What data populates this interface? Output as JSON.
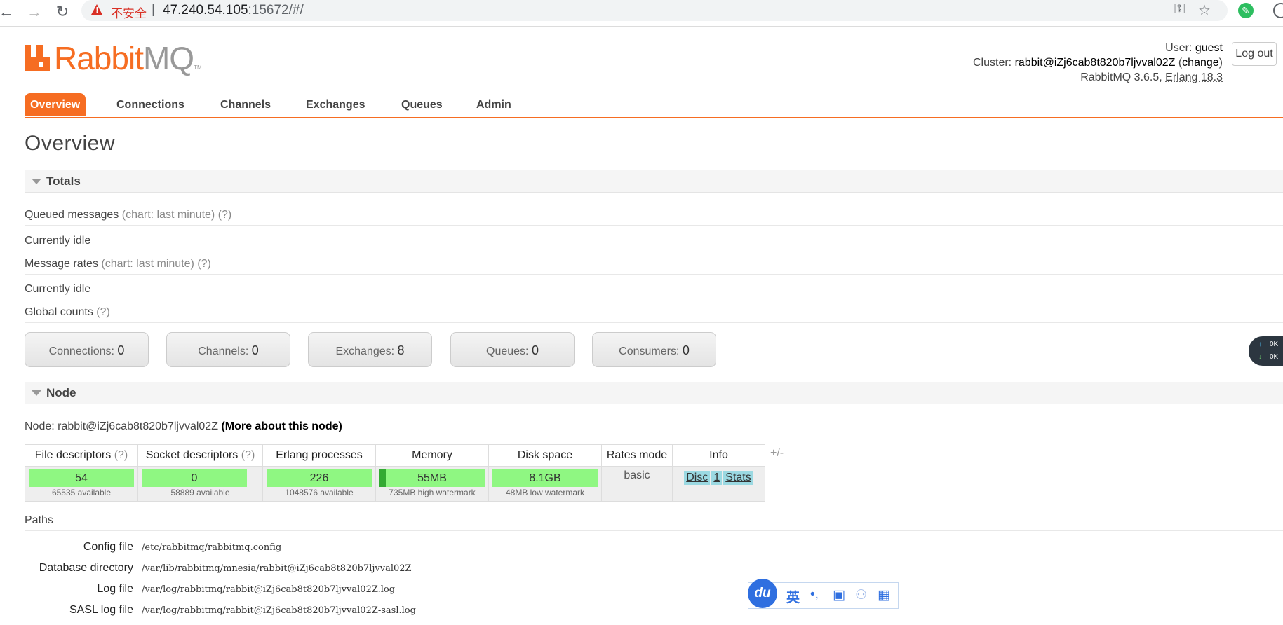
{
  "browser": {
    "insecure_label": "不安全",
    "url_host": "47.240.54.105",
    "url_rest": ":15672/#/"
  },
  "logo": {
    "rabbit": "Rabbit",
    "mq": "MQ",
    "tm": "TM"
  },
  "header": {
    "user_label": "User:",
    "user": "guest",
    "cluster_label": "Cluster:",
    "cluster": "rabbit@iZj6cab8t820b7ljvval02Z",
    "change": "change",
    "version": "RabbitMQ 3.6.5,",
    "erlang": "Erlang 18.3",
    "logout": "Log out"
  },
  "tabs": [
    "Overview",
    "Connections",
    "Channels",
    "Exchanges",
    "Queues",
    "Admin"
  ],
  "page_title": "Overview",
  "totals": {
    "title": "Totals",
    "queued_label": "Queued messages",
    "queued_hint": "(chart: last minute) (?)",
    "idle1": "Currently idle",
    "rates_label": "Message rates",
    "rates_hint": "(chart: last minute) (?)",
    "idle2": "Currently idle",
    "global_label": "Global counts",
    "global_hint": "(?)"
  },
  "counts": [
    {
      "label": "Connections:",
      "value": "0"
    },
    {
      "label": "Channels:",
      "value": "0"
    },
    {
      "label": "Exchanges:",
      "value": "8"
    },
    {
      "label": "Queues:",
      "value": "0"
    },
    {
      "label": "Consumers:",
      "value": "0"
    }
  ],
  "net_widget": {
    "up": "0K",
    "down": "0K"
  },
  "node": {
    "title": "Node",
    "node_label": "Node:",
    "node_name": "rabbit@iZj6cab8t820b7ljvval02Z",
    "more": "(More about this node)",
    "plusminus": "+/-",
    "headers": {
      "fd": "File descriptors",
      "fd_q": "(?)",
      "sd": "Socket descriptors",
      "sd_q": "(?)",
      "ep": "Erlang processes",
      "mem": "Memory",
      "disk": "Disk space",
      "rates": "Rates mode",
      "info": "Info"
    },
    "fd": {
      "value": "54",
      "sub": "65535 available"
    },
    "sd": {
      "value": "0",
      "sub": "58889 available"
    },
    "ep": {
      "value": "226",
      "sub": "1048576 available"
    },
    "mem": {
      "value": "55MB",
      "sub": "735MB high watermark",
      "fill": 0.06
    },
    "disk": {
      "value": "8.1GB",
      "sub": "48MB low watermark"
    },
    "rates_mode": "basic",
    "info": [
      "Disc",
      "1",
      "Stats"
    ]
  },
  "paths": {
    "title": "Paths",
    "rows": [
      {
        "k": "Config file",
        "v": "/etc/rabbitmq/rabbitmq.config"
      },
      {
        "k": "Database directory",
        "v": "/var/lib/rabbitmq/mnesia/rabbit@iZj6cab8t820b7ljvval02Z"
      },
      {
        "k": "Log file",
        "v": "/var/log/rabbitmq/rabbit@iZj6cab8t820b7ljvval02Z.log"
      },
      {
        "k": "SASL log file",
        "v": "/var/log/rabbitmq/rabbit@iZj6cab8t820b7ljvval02Z-sasl.log"
      }
    ]
  },
  "ime": {
    "logo": "du",
    "lang": "英"
  }
}
